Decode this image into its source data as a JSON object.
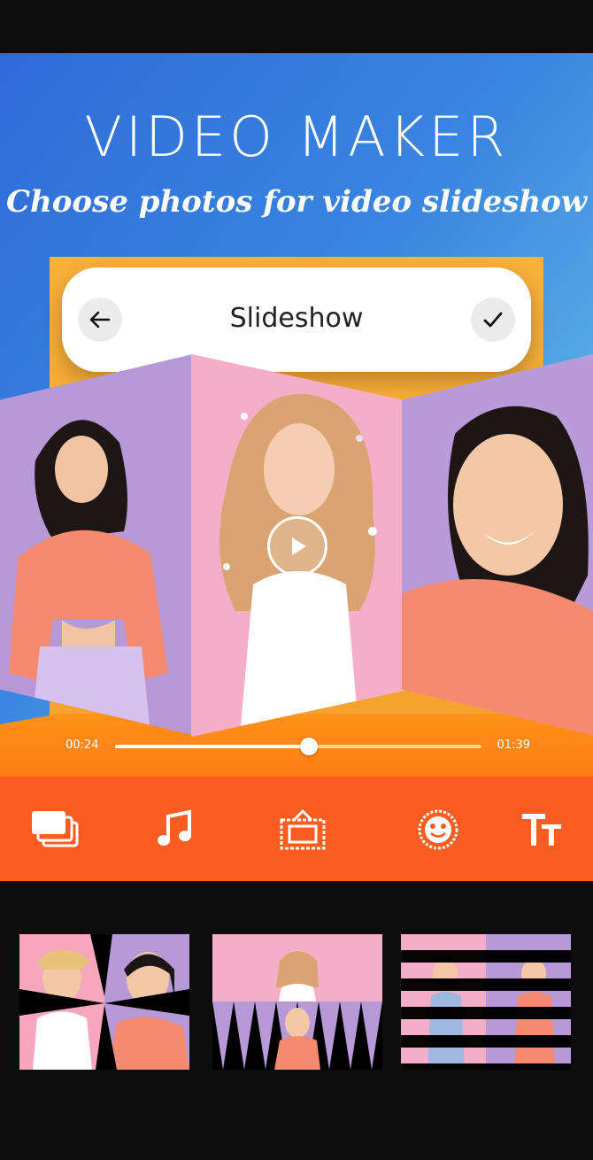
{
  "hero": {
    "title": "VIDEO MAKER",
    "subtitle": "Choose photos for video slideshow"
  },
  "topbar": {
    "title": "Slideshow",
    "back_icon": "arrow-left-icon",
    "confirm_icon": "check-icon"
  },
  "player": {
    "play_icon": "play-icon",
    "current_time": "00:24",
    "total_time": "01:39",
    "progress": 0.53
  },
  "toolbar": {
    "tools": [
      {
        "name": "images",
        "icon": "images-stack-icon"
      },
      {
        "name": "music",
        "icon": "music-note-icon"
      },
      {
        "name": "frame",
        "icon": "frame-icon"
      },
      {
        "name": "sticker",
        "icon": "emoji-sticker-icon"
      },
      {
        "name": "text",
        "icon": "text-icon"
      }
    ]
  },
  "transitions": [
    "collage-transition",
    "triangles-transition",
    "stripes-transition"
  ],
  "colors": {
    "toolbar": "#fb5c21",
    "frame": "#f8b13a",
    "hero_start": "#2f6bd8",
    "hero_end": "#8fd6ea"
  }
}
